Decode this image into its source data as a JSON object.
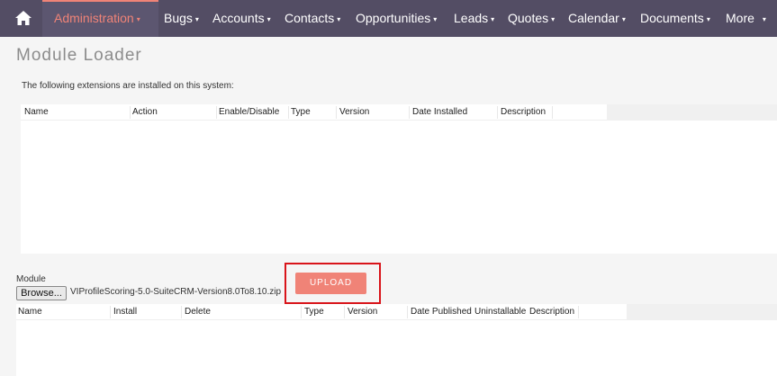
{
  "nav": {
    "home_icon": "home-icon",
    "items": [
      {
        "label": "Administration",
        "active": true
      },
      {
        "label": "Bugs"
      },
      {
        "label": "Accounts"
      },
      {
        "label": "Contacts"
      },
      {
        "label": "Opportunities"
      },
      {
        "label": "Leads"
      },
      {
        "label": "Quotes"
      },
      {
        "label": "Calendar"
      },
      {
        "label": "Documents"
      },
      {
        "label": "More"
      }
    ],
    "caret": "▾",
    "colors": {
      "bar": "#534d64",
      "active": "#f08377",
      "text": "#ffffff"
    }
  },
  "page": {
    "title": "Module Loader",
    "intro": "The following extensions are installed on this system:"
  },
  "installed_table": {
    "columns": [
      "Name",
      "Action",
      "Enable/Disable",
      "Type",
      "Version",
      "Date Installed",
      "Description"
    ],
    "rows": []
  },
  "upload": {
    "module_label": "Module",
    "browse_label": "Browse...",
    "file_name": "VIProfileScoring-5.0-SuiteCRM-Version8.0To8.10.zip",
    "upload_label": "UPLOAD",
    "button_color": "#f08377",
    "highlight_color": "#d9141a"
  },
  "uploaded_table": {
    "columns": [
      "Name",
      "Install",
      "Delete",
      "Type",
      "Version",
      "Date Published",
      "Uninstallable",
      "Description"
    ],
    "rows": []
  }
}
